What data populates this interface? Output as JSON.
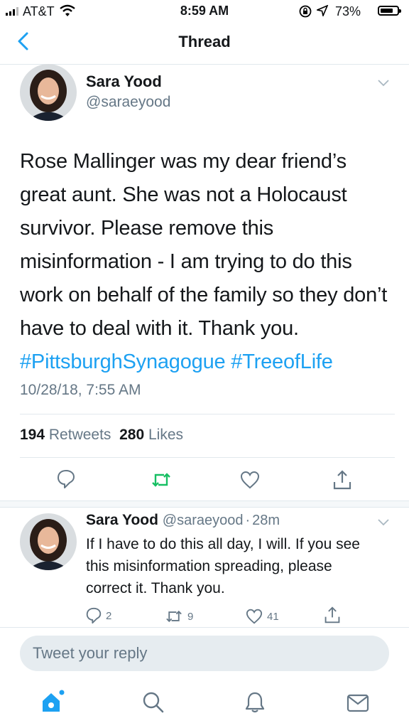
{
  "status_bar": {
    "carrier": "AT&T",
    "time": "8:59 AM",
    "battery_pct": "73%",
    "icons": [
      "signal-icon",
      "wifi-icon",
      "lock-rotation-icon",
      "location-icon",
      "battery-icon"
    ]
  },
  "header": {
    "title": "Thread",
    "back_icon": "chevron-left-icon"
  },
  "main_tweet": {
    "name": "Sara Yood",
    "handle": "@saraeyood",
    "text": "Rose Mallinger was my dear friend’s great aunt. She was not a Holocaust survivor. Please remove this misinformation - I am trying to do this work on behalf of the family so they don’t have to deal with it. Thank you. ",
    "hashtags": "#PittsburghSynagogue #TreeofLife",
    "timestamp": "10/28/18, 7:55 AM",
    "retweets_count": "194",
    "retweets_label": "Retweets",
    "likes_count": "280",
    "likes_label": "Likes"
  },
  "reply_tweet": {
    "name": "Sara Yood",
    "handle": "@saraeyood",
    "separator": "·",
    "age": "28m",
    "text": "If I have to do this all day, I will. If you see this misinformation spreading, please correct it. Thank you.",
    "reply_count": "2",
    "retweet_count": "9",
    "like_count": "41"
  },
  "reply_input": {
    "placeholder": "Tweet your reply"
  },
  "tab_bar": {
    "items": [
      "home-icon",
      "search-icon",
      "notifications-icon",
      "messages-icon"
    ]
  },
  "colors": {
    "accent": "#1da1f2",
    "retweet_green": "#17bf63",
    "muted": "#657786",
    "divider": "#e1e8ed"
  }
}
